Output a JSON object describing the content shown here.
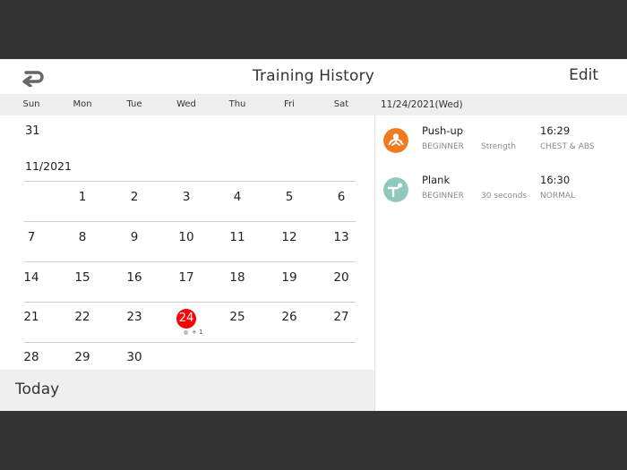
{
  "header": {
    "title": "Training History",
    "edit_label": "Edit",
    "back_icon": "back-arrow-icon"
  },
  "weekdays": [
    "Sun",
    "Mon",
    "Tue",
    "Wed",
    "Thu",
    "Fri",
    "Sat"
  ],
  "selected_date_label": "11/24/2021(Wed)",
  "calendar": {
    "prev_month_tail": "31",
    "month_label": "11/2021",
    "weeks": [
      [
        "",
        "1",
        "2",
        "3",
        "4",
        "5",
        "6"
      ],
      [
        "7",
        "8",
        "9",
        "10",
        "11",
        "12",
        "13"
      ],
      [
        "14",
        "15",
        "16",
        "17",
        "18",
        "19",
        "20"
      ],
      [
        "21",
        "22",
        "23",
        "24",
        "25",
        "26",
        "27"
      ],
      [
        "28",
        "29",
        "30",
        "",
        "",
        "",
        ""
      ]
    ],
    "selected_day": "24",
    "selected_more": "+ 1",
    "selected_color": "#ff0000"
  },
  "today_label": "Today",
  "workouts": [
    {
      "name": "Push-up",
      "time": "16:29",
      "level": "BEGINNER",
      "detail": "Strength",
      "tag": "CHEST & ABS",
      "icon": "push-up-icon",
      "color": "#f07a1e"
    },
    {
      "name": "Plank",
      "time": "16:30",
      "level": "BEGINNER",
      "detail": "30 seconds",
      "tag": "NORMAL",
      "icon": "plank-icon",
      "color": "#8ec9bb"
    }
  ]
}
